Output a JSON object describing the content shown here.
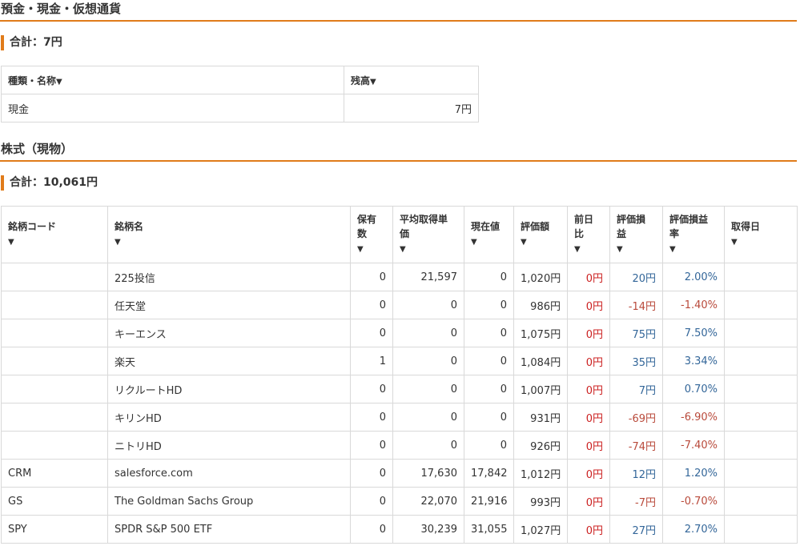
{
  "deposits": {
    "section_title": "預金・現金・仮想通貨",
    "total_label": "合計：7円",
    "columns": {
      "type": "種類・名称",
      "balance": "残高"
    },
    "sort_icon": "▼",
    "rows": [
      {
        "type": "現金",
        "balance": "7円"
      }
    ]
  },
  "stocks": {
    "section_title": "株式（現物）",
    "total_label": "合計：10,061円",
    "sort_icon": "▼",
    "columns": {
      "code": "銘柄コード",
      "name": "銘柄名",
      "qty_1": "保有",
      "qty_2": "数",
      "avg_1": "平均取得単",
      "avg_2": "価",
      "price": "現在値",
      "value": "評価額",
      "prev_1": "前日",
      "prev_2": "比",
      "pl_1": "評価損",
      "pl_2": "益",
      "plr_1": "評価損益",
      "plr_2": "率",
      "date": "取得日"
    },
    "rows": [
      {
        "code": "",
        "name": "225投信",
        "qty": "0",
        "avg": "21,597",
        "price": "0",
        "value": "1,020円",
        "prev": "0円",
        "pl": "20円",
        "plr": "2.00%",
        "sign": "pos",
        "date": ""
      },
      {
        "code": "",
        "name": "任天堂",
        "qty": "0",
        "avg": "0",
        "price": "0",
        "value": "986円",
        "prev": "0円",
        "pl": "-14円",
        "plr": "-1.40%",
        "sign": "neg",
        "date": ""
      },
      {
        "code": "",
        "name": "キーエンス",
        "qty": "0",
        "avg": "0",
        "price": "0",
        "value": "1,075円",
        "prev": "0円",
        "pl": "75円",
        "plr": "7.50%",
        "sign": "pos",
        "date": ""
      },
      {
        "code": "",
        "name": "楽天",
        "qty": "1",
        "avg": "0",
        "price": "0",
        "value": "1,084円",
        "prev": "0円",
        "pl": "35円",
        "plr": "3.34%",
        "sign": "pos",
        "date": ""
      },
      {
        "code": "",
        "name": "リクルートHD",
        "qty": "0",
        "avg": "0",
        "price": "0",
        "value": "1,007円",
        "prev": "0円",
        "pl": "7円",
        "plr": "0.70%",
        "sign": "pos",
        "date": ""
      },
      {
        "code": "",
        "name": "キリンHD",
        "qty": "0",
        "avg": "0",
        "price": "0",
        "value": "931円",
        "prev": "0円",
        "pl": "-69円",
        "plr": "-6.90%",
        "sign": "neg",
        "date": ""
      },
      {
        "code": "",
        "name": "ニトリHD",
        "qty": "0",
        "avg": "0",
        "price": "0",
        "value": "926円",
        "prev": "0円",
        "pl": "-74円",
        "plr": "-7.40%",
        "sign": "neg",
        "date": ""
      },
      {
        "code": "CRM",
        "name": "salesforce.com",
        "qty": "0",
        "avg": "17,630",
        "price": "17,842",
        "value": "1,012円",
        "prev": "0円",
        "pl": "12円",
        "plr": "1.20%",
        "sign": "pos",
        "date": ""
      },
      {
        "code": "GS",
        "name": "The Goldman Sachs Group",
        "qty": "0",
        "avg": "22,070",
        "price": "21,916",
        "value": "993円",
        "prev": "0円",
        "pl": "-7円",
        "plr": "-0.70%",
        "sign": "neg",
        "date": ""
      },
      {
        "code": "SPY",
        "name": "SPDR S&P 500 ETF",
        "qty": "0",
        "avg": "30,239",
        "price": "31,055",
        "value": "1,027円",
        "prev": "0円",
        "pl": "27円",
        "plr": "2.70%",
        "sign": "pos",
        "date": ""
      }
    ]
  },
  "colors": {
    "accent": "#e07b1a",
    "positive": "#336699",
    "negative": "#b94a3b",
    "zero": "#cc2222"
  }
}
